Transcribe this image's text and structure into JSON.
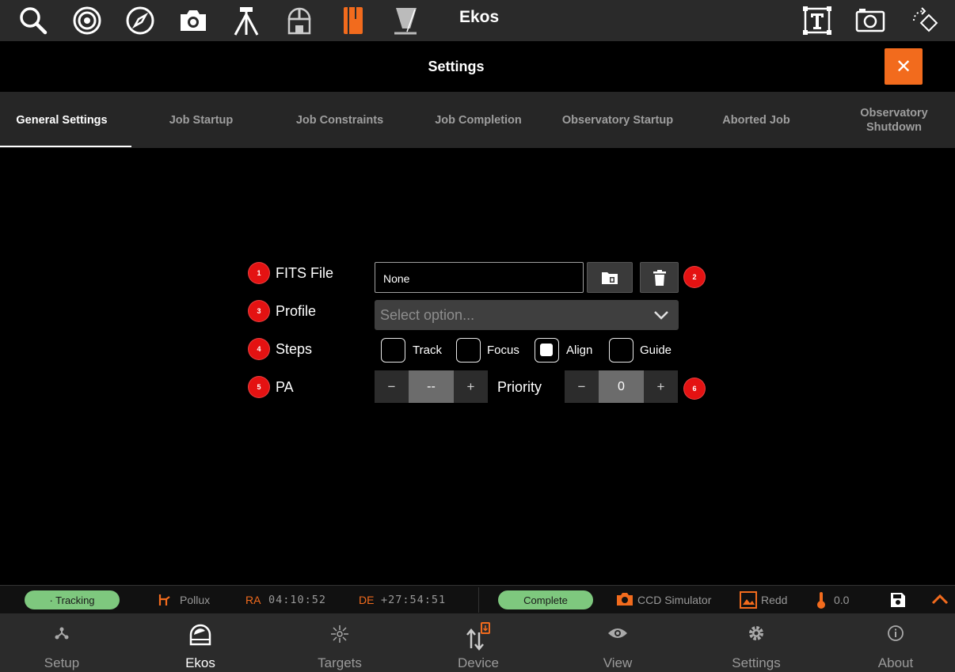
{
  "app": {
    "title": "Ekos"
  },
  "toolbar": {
    "icons": [
      "search-icon",
      "target-icon",
      "compass-icon",
      "camera-icon",
      "tripod-icon",
      "observatory-icon",
      "notebook-icon",
      "flat-field-icon",
      "text-box-icon",
      "snapshot-icon",
      "rotate-icon"
    ],
    "accent": "#f26b1d"
  },
  "settings": {
    "title": "Settings",
    "close_glyph": "✕"
  },
  "tabs": [
    {
      "label": "General Settings",
      "active": true
    },
    {
      "label": "Job Startup"
    },
    {
      "label": "Job Constraints"
    },
    {
      "label": "Job Completion"
    },
    {
      "label": "Observatory Startup"
    },
    {
      "label": "Aborted Job"
    },
    {
      "label": "Observatory Shutdown"
    }
  ],
  "form": {
    "badges": [
      "1",
      "2",
      "3",
      "4",
      "5",
      "6"
    ],
    "fits_label": "FITS File",
    "fits_value": "None",
    "profile_label": "Profile",
    "profile_placeholder": "Select option...",
    "steps_label": "Steps",
    "steps": [
      {
        "label": "Track",
        "checked": false
      },
      {
        "label": "Focus",
        "checked": false
      },
      {
        "label": "Align",
        "checked": true
      },
      {
        "label": "Guide",
        "checked": false
      }
    ],
    "pa_label": "PA",
    "pa_value": "--",
    "priority_label": "Priority",
    "priority_value": "0",
    "minus": "−",
    "plus": "+"
  },
  "status": {
    "tracking": "· Tracking",
    "target": "Pollux",
    "ra_label": "RA",
    "ra_value": "04:10:52",
    "de_label": "DE",
    "de_value": "+27:54:51",
    "complete": "Complete",
    "camera": "CCD Simulator",
    "filter": "Redd",
    "temperature": "0.0",
    "pill_color": "#7ec87e"
  },
  "nav": [
    {
      "label": "Setup",
      "icon": "setup-icon"
    },
    {
      "label": "Ekos",
      "icon": "ekos-icon",
      "active": true
    },
    {
      "label": "Targets",
      "icon": "targets-icon"
    },
    {
      "label": "Device",
      "icon": "device-icon"
    },
    {
      "label": "View",
      "icon": "view-icon"
    },
    {
      "label": "Settings",
      "icon": "settings-icon"
    },
    {
      "label": "About",
      "icon": "about-icon"
    }
  ]
}
